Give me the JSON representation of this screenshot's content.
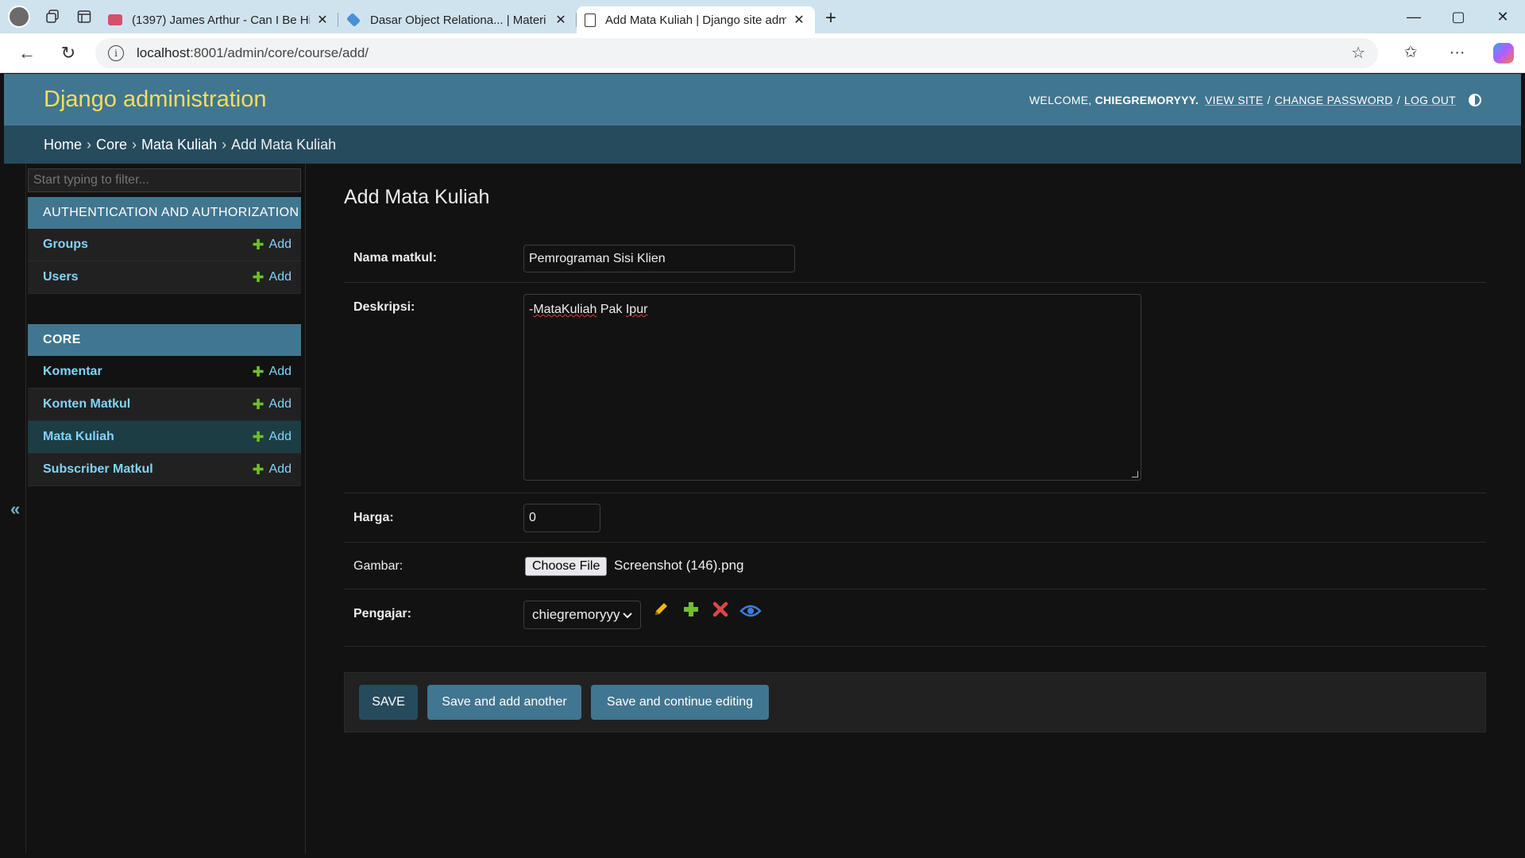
{
  "browser": {
    "tabs": [
      {
        "title": "(1397) James Arthur - Can I Be Him",
        "close": "✕",
        "favicon_color": "#d5506c"
      },
      {
        "title": "Dasar Object Relationa... | Materi I",
        "close": "✕",
        "favicon_color": "#4a8fd6"
      },
      {
        "title": "Add Mata Kuliah | Django site adm",
        "close": "✕",
        "favicon_color": "#ffffff"
      }
    ],
    "url_host": "localhost",
    "url_rest": ":8001/admin/core/course/add/",
    "new_tab": "+",
    "window_controls": [
      "—",
      "▢",
      "✕"
    ]
  },
  "admin": {
    "branding": "Django administration",
    "welcome": "WELCOME,",
    "username": "CHIEGREMORYYY.",
    "view_site": "VIEW SITE",
    "change_password": "CHANGE PASSWORD",
    "log_out": "LOG OUT",
    "sep": "/",
    "breadcrumbs": [
      "Home",
      "Core",
      "Mata Kuliah",
      "Add Mata Kuliah"
    ],
    "crumb_sep": "›",
    "sidebar_toggle": "«"
  },
  "sidebar": {
    "filter_placeholder": "Start typing to filter...",
    "add_label": "Add",
    "plus": "✚",
    "modules": [
      {
        "caption": "AUTHENTICATION AND AUTHORIZATION",
        "models": [
          "Groups",
          "Users"
        ]
      },
      {
        "caption": "CORE",
        "models": [
          "Komentar",
          "Konten Matkul",
          "Mata Kuliah",
          "Subscriber Matkul"
        ],
        "current": "Mata Kuliah"
      }
    ]
  },
  "form": {
    "title": "Add Mata Kuliah",
    "nama_label": "Nama matkul:",
    "nama_value": "Pemrograman Sisi Klien",
    "deskripsi_label": "Deskripsi:",
    "deskripsi_prefix": "-",
    "deskripsi_w1": "MataKuliah",
    "deskripsi_w2": "Pak",
    "deskripsi_w3": "Ipur",
    "harga_label": "Harga:",
    "harga_value": "0",
    "gambar_label": "Gambar:",
    "choose_file": "Choose File",
    "file_name": "Screenshot (146).png",
    "pengajar_label": "Pengajar:",
    "pengajar_value": "chiegremoryyy",
    "icons": {
      "edit": "pencil-icon",
      "add": "plus-icon",
      "delete": "delete-icon",
      "view": "eye-icon"
    }
  },
  "buttons": {
    "save": "SAVE",
    "save_add_another": "Save and add another",
    "save_continue": "Save and continue editing"
  },
  "colors": {
    "header": "#417690",
    "breadcrumbs": "#264b5d",
    "branding": "#f5dd5d",
    "link": "#81d4fa",
    "add_green": "#70bf2b"
  }
}
